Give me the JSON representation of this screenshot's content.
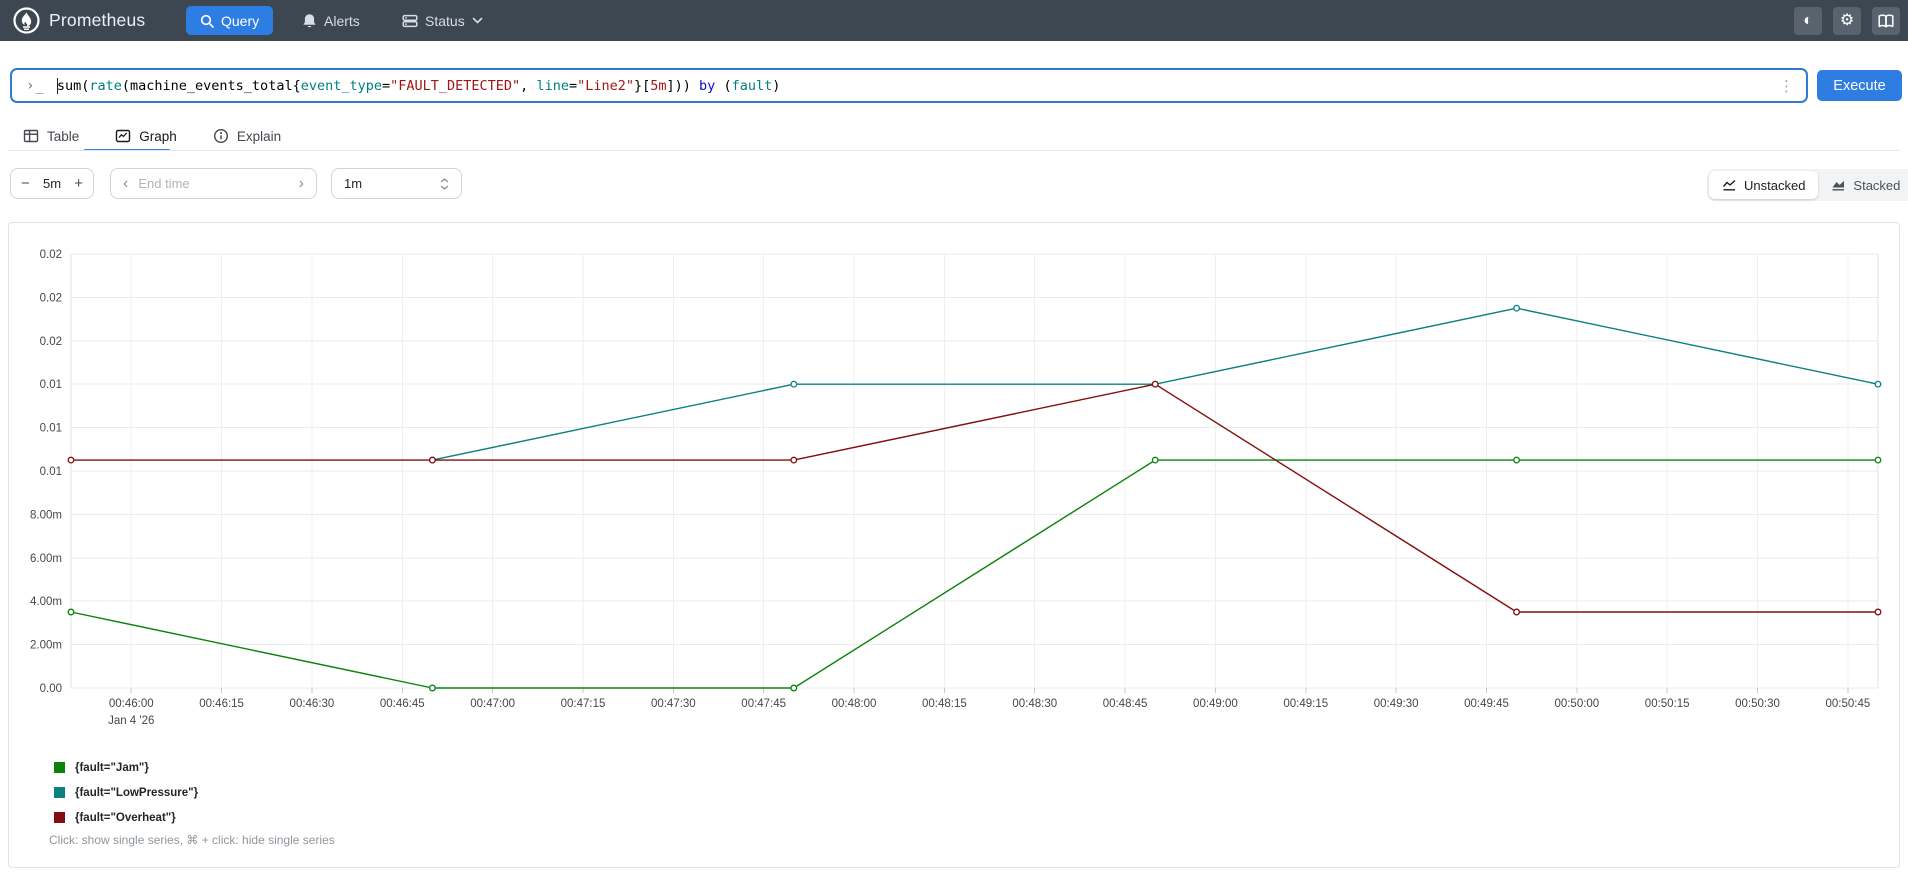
{
  "navbar": {
    "title": "Prometheus",
    "query_label": "Query",
    "alerts_label": "Alerts",
    "status_label": "Status"
  },
  "query_bar": {
    "prompt": "›_",
    "tokens": [
      {
        "text": "sum(",
        "type": "plain"
      },
      {
        "text": "rate",
        "type": "fn"
      },
      {
        "text": "(machine_events_total{",
        "type": "plain"
      },
      {
        "text": "event_type",
        "type": "label"
      },
      {
        "text": "=",
        "type": "plain"
      },
      {
        "text": "\"FAULT_DETECTED\"",
        "type": "str"
      },
      {
        "text": ", ",
        "type": "plain"
      },
      {
        "text": "line",
        "type": "label"
      },
      {
        "text": "=",
        "type": "plain"
      },
      {
        "text": "\"Line2\"",
        "type": "str"
      },
      {
        "text": "}[",
        "type": "plain"
      },
      {
        "text": "5m",
        "type": "dur"
      },
      {
        "text": "])) ",
        "type": "plain"
      },
      {
        "text": "by",
        "type": "kw"
      },
      {
        "text": " (",
        "type": "plain"
      },
      {
        "text": "fault",
        "type": "label"
      },
      {
        "text": ")",
        "type": "plain"
      }
    ],
    "kebab": "⋮",
    "execute_label": "Execute"
  },
  "tabs": {
    "table": "Table",
    "graph": "Graph",
    "explain": "Explain",
    "active": "Graph"
  },
  "controls": {
    "minus_label": "−",
    "range_value": "5m",
    "plus_label": "+",
    "prev_label": "‹",
    "end_time_placeholder": "End time",
    "next_label": "›",
    "resolution_value": "1m",
    "unstacked_label": "Unstacked",
    "stacked_label": "Stacked"
  },
  "chart_data": {
    "type": "line",
    "x_start": "00:45:50",
    "x_end": "00:50:50",
    "x_span_s": 300,
    "x_tick_first_offset_s": 10,
    "x_tick_step_s": 15,
    "x_tick_labels": [
      "00:46:00",
      "00:46:15",
      "00:46:30",
      "00:46:45",
      "00:47:00",
      "00:47:15",
      "00:47:30",
      "00:47:45",
      "00:48:00",
      "00:48:15",
      "00:48:30",
      "00:48:45",
      "00:49:00",
      "00:49:15",
      "00:49:30",
      "00:49:45",
      "00:50:00",
      "00:50:15",
      "00:50:30",
      "00:50:45"
    ],
    "x_date_label": "Jan 4 '26",
    "y_tick_labels": [
      "0.02",
      "0.02",
      "0.02",
      "0.01",
      "0.01",
      "0.01",
      "8.00m",
      "6.00m",
      "4.00m",
      "2.00m",
      "0.00"
    ],
    "ylim": [
      0,
      0.02
    ],
    "y_tick_step": 0.002,
    "grid": true,
    "legend_position": "bottom-left",
    "x_unit": "seconds since 00:45:50, points every 60s",
    "series": [
      {
        "name": "{fault=\"Jam\"}",
        "color": "#0b830b",
        "points": [
          [
            0,
            0.0035
          ],
          [
            60,
            0
          ],
          [
            120,
            0
          ],
          [
            180,
            0.0105
          ],
          [
            240,
            0.0105
          ],
          [
            300,
            0.0105
          ]
        ]
      },
      {
        "name": "{fault=\"LowPressure\"}",
        "color": "#0d8080",
        "points": [
          [
            60,
            0.0105
          ],
          [
            120,
            0.014
          ],
          [
            180,
            0.014
          ],
          [
            240,
            0.0175
          ],
          [
            300,
            0.014
          ]
        ]
      },
      {
        "name": "{fault=\"Overheat\"}",
        "color": "#840d0d",
        "points": [
          [
            0,
            0.0105
          ],
          [
            60,
            0.0105
          ],
          [
            120,
            0.0105
          ],
          [
            180,
            0.014
          ],
          [
            240,
            0.0035
          ],
          [
            300,
            0.0035
          ]
        ]
      }
    ]
  },
  "legend_hint": "Click: show single series, ⌘ + click: hide single series",
  "colors": {
    "accent_blue": "#2e7de2",
    "input_focus_border": "#2f7bd1",
    "navbar_bg": "#3d4752"
  }
}
